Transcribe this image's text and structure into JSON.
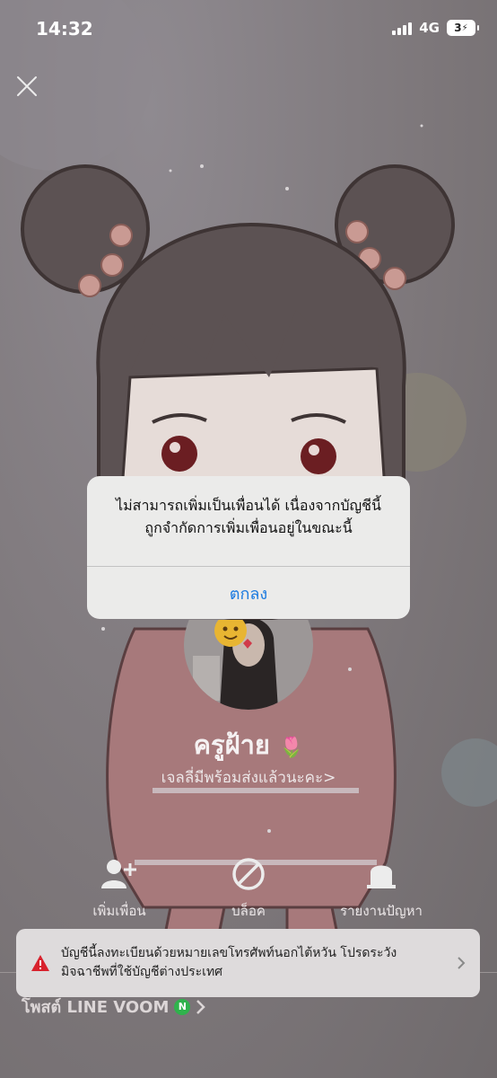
{
  "status_bar": {
    "time": "14:32",
    "network": "4G",
    "battery": "3"
  },
  "profile": {
    "name": "ครูฝ้าย",
    "name_emoji": "🌷",
    "status_message": "เจลลี่มีพร้อมส่งแล้วนะคะ>"
  },
  "actions": [
    {
      "label": "เพิ่มเพื่อน",
      "icon": "add-friend-icon"
    },
    {
      "label": "บล็อค",
      "icon": "block-icon"
    },
    {
      "label": "รายงานปัญหา",
      "icon": "report-icon"
    }
  ],
  "warning": {
    "line1": "บัญชีนี้ลงทะเบียนด้วยหมายเลขโทรศัพท์นอกไต้หวัน โปรดระวัง",
    "line2": "มิจฉาชีพที่ใช้บัญชีต่างประเทศ"
  },
  "voom": {
    "label": "โพสต์ LINE VOOM",
    "badge": "N"
  },
  "dialog": {
    "line1": "ไม่สามารถเพิ่มเป็นเพื่อนได้ เนื่องจากบัญชีนี้",
    "line2": "ถูกจำกัดการเพิ่มเพื่อนอยู่ในขณะนี้",
    "ok_label": "ตกลง"
  },
  "colors": {
    "accent": "#1a7ae0",
    "warning": "#d8222d",
    "voom_badge": "#2fb24c"
  }
}
